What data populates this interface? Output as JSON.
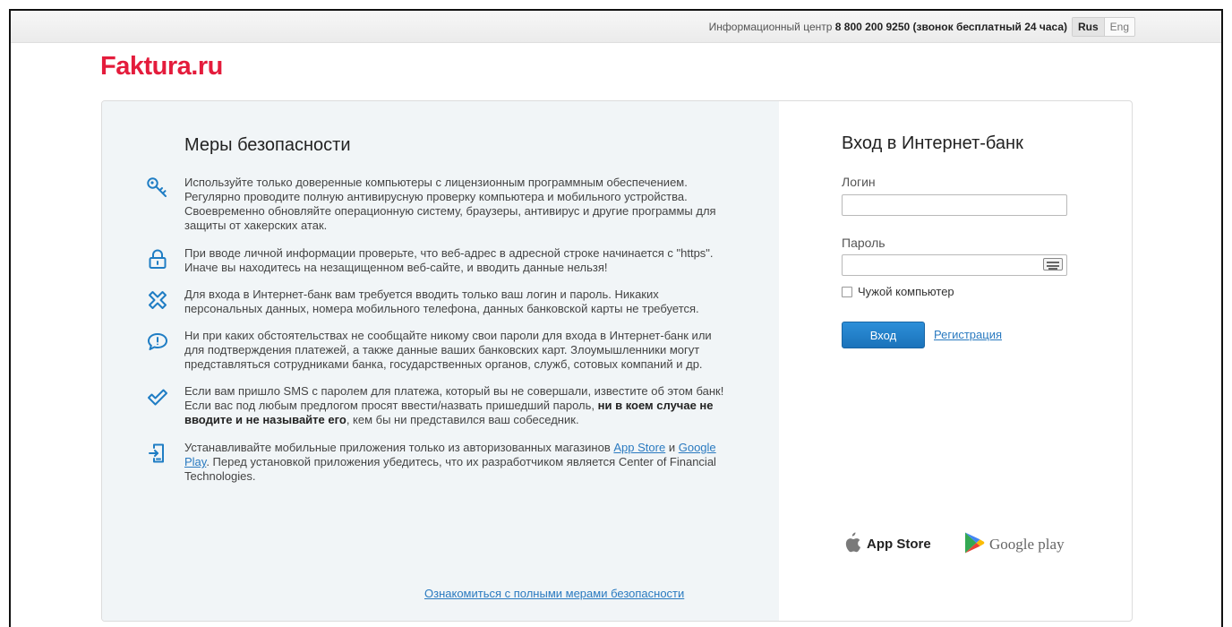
{
  "topbar": {
    "info_prefix": "Информационный центр",
    "phone": "8 800 200 9250 (звонок бесплатный 24 часа)",
    "lang_active": "Rus",
    "lang_inactive": "Eng"
  },
  "logo": {
    "text": "Faktura.ru"
  },
  "security": {
    "title": "Меры безопасности",
    "items": [
      {
        "icon": "key-icon",
        "text": "Используйте только доверенные компьютеры с лицензионным программным обеспечением. Регулярно проводите полную антивирусную проверку компьютера и мобильного устройства. Своевременно обновляйте операционную систему, браузеры, антивирус и другие программы для защиты от хакерских атак."
      },
      {
        "icon": "lock-icon",
        "text": "При вводе личной информации проверьте, что веб-адрес в адресной строке начинается с \"https\". Иначе вы находитесь на незащищенном веб-сайте, и вводить данные нельзя!"
      },
      {
        "icon": "x-icon",
        "text": "Для входа в Интернет-банк вам требуется вводить только ваш логин и пароль. Никаких персональных данных, номера мобильного телефона, данных банковской карты не требуется."
      },
      {
        "icon": "speech-bubble-icon",
        "text": "Ни при каких обстоятельствах не сообщайте никому свои пароли для входа в Интернет-банк или для подтверждения платежей, а также данные ваших банковских карт. Злоумышленники могут представляться сотрудниками банка, государственных органов, служб, сотовых компаний и др."
      },
      {
        "icon": "checkmark-icon",
        "text_before": "Если вам пришло SMS с паролем для платежа, который вы не совершали, известите об этом банк! Если вас под любым предлогом просят ввести/назвать пришедший пароль,",
        "text_bold": "ни в коем случае не вводите и не называйте его",
        "text_after": ", кем бы ни представился ваш собеседник."
      },
      {
        "icon": "mobile-download-icon",
        "text_before": "Устанавливайте мобильные приложения только из авторизованных магазинов",
        "link1": "App Store",
        "text_mid": "и",
        "link2": "Google Play",
        "text_after": ". Перед установкой приложения убедитесь, что их разработчиком является Center of Financial Technologies."
      }
    ],
    "full_link": "Ознакомиться с полными мерами безопасности"
  },
  "login": {
    "title": "Вход в Интернет-банк",
    "login_label": "Логин",
    "login_value": "",
    "password_label": "Пароль",
    "password_value": "",
    "foreign_pc_label": "Чужой компьютер",
    "submit_label": "Вход",
    "register_label": "Регистрация"
  },
  "stores": {
    "apple": "App Store",
    "google": "Google play"
  },
  "colors": {
    "brand": "#e41c3c",
    "link": "#2a7ac0",
    "button": "#1f7dc4",
    "icon": "#1f7dc4",
    "panel": "#f1f5f7"
  }
}
